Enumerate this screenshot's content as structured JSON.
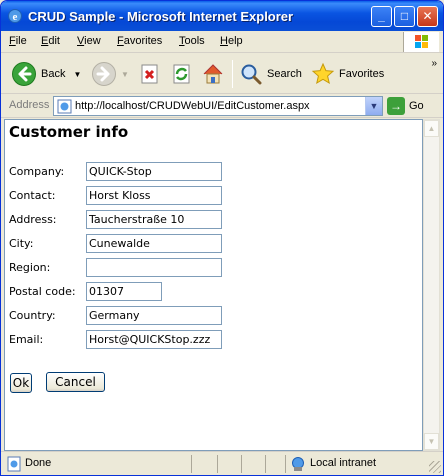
{
  "window": {
    "title": "CRUD Sample - Microsoft Internet Explorer",
    "min_glyph": "_",
    "max_glyph": "□",
    "close_glyph": "✕"
  },
  "menu": {
    "items": [
      {
        "label": "File"
      },
      {
        "label": "Edit"
      },
      {
        "label": "View"
      },
      {
        "label": "Favorites"
      },
      {
        "label": "Tools"
      },
      {
        "label": "Help"
      }
    ]
  },
  "toolbar": {
    "back_label": "Back",
    "search_label": "Search",
    "favorites_label": "Favorites",
    "more_glyph": "»"
  },
  "address": {
    "label": "Address",
    "url": "http://localhost/CRUDWebUI/EditCustomer.aspx",
    "go_label": "Go",
    "go_glyph": "→",
    "drop_glyph": "▼"
  },
  "page": {
    "title": "Customer info",
    "fields": [
      {
        "label": "Company:",
        "value": "QUICK-Stop"
      },
      {
        "label": "Contact:",
        "value": "Horst Kloss"
      },
      {
        "label": "Address:",
        "value": "Taucherstraße 10"
      },
      {
        "label": "City:",
        "value": "Cunewalde"
      },
      {
        "label": "Region:",
        "value": ""
      },
      {
        "label": "Postal code:",
        "value": "01307"
      },
      {
        "label": "Country:",
        "value": "Germany"
      },
      {
        "label": "Email:",
        "value": "Horst@QUICKStop.zzz"
      }
    ],
    "ok_label": "Ok",
    "cancel_label": "Cancel"
  },
  "status": {
    "text": "Done",
    "zone": "Local intranet"
  },
  "scroll": {
    "up_glyph": "▲",
    "down_glyph": "▼"
  }
}
